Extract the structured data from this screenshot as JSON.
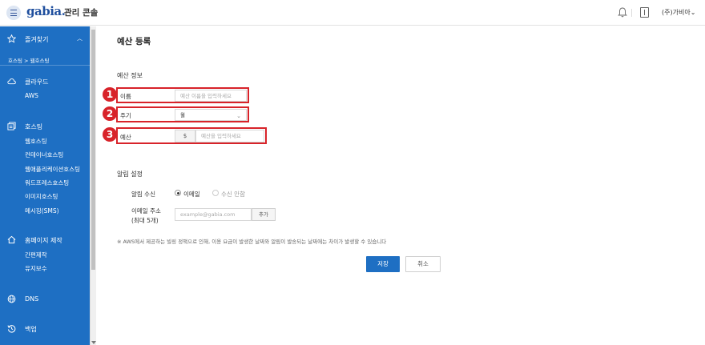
{
  "topbar": {
    "logo": "gabia.",
    "logo_sub": "관리 콘솔",
    "user": "(주)가비아",
    "user_caret": "⌄"
  },
  "sidebar": {
    "favorites": "즐겨찾기",
    "breadcrumb": "호스팅 > 웹호스팅",
    "cloud": "클라우드",
    "cloud_items": [
      "AWS"
    ],
    "hosting": "호스팅",
    "hosting_items": [
      "웹호스팅",
      "컨테이너호스팅",
      "웹애플리케이션호스팅",
      "워드프레스호스팅",
      "이미지호스팅",
      "메시징(SMS)"
    ],
    "homepage": "홈페이지 제작",
    "homepage_items": [
      "간편제작",
      "유지보수"
    ],
    "dns": "DNS",
    "backup": "백업"
  },
  "main": {
    "title": "예산 등록",
    "budget_info": {
      "title": "예산 정보",
      "name_label": "이름",
      "name_placeholder": "예산 이름을 입력하세요",
      "period_label": "주기",
      "period_value": "월",
      "amount_label": "예산",
      "amount_unit": "$",
      "amount_placeholder": "예산을 입력하세요"
    },
    "alert": {
      "title": "알림 설정",
      "receive_label": "알림 수신",
      "option_email": "이메일",
      "option_none": "수신 안함",
      "selected": "이메일",
      "email_label_1": "이메일 주소",
      "email_label_2": "(최대 5개)",
      "email_placeholder": "example@gabia.com",
      "add_button": "추가"
    },
    "notice": "※ AWS에서 제공하는 빌링 정책으로 인해, 이용 요금이 발생한 날짜와 알림이 발송되는 날짜에는 차이가 발생할 수 있습니다",
    "save": "저장",
    "cancel": "취소"
  },
  "badges": [
    "1",
    "2",
    "3"
  ],
  "colors": {
    "sidebar_bg": "#1e6fc3",
    "primary": "#1e6fc3",
    "highlight": "#d8232a"
  }
}
